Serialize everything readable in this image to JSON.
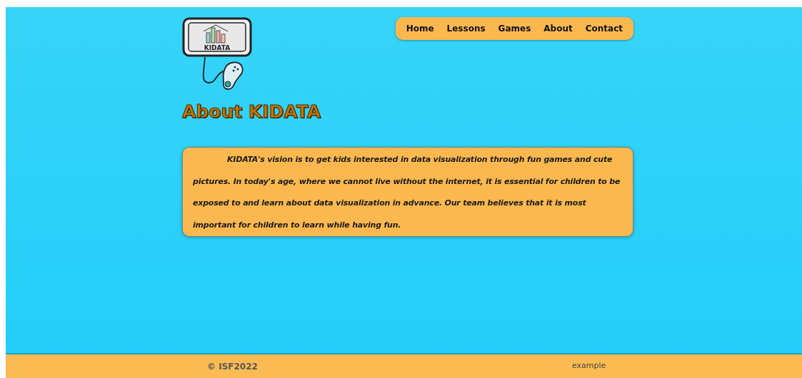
{
  "logo": {
    "text": "KIDATA"
  },
  "nav": [
    {
      "label": "Home"
    },
    {
      "label": "Lessons"
    },
    {
      "label": "Games"
    },
    {
      "label": "About"
    },
    {
      "label": "Contact"
    }
  ],
  "heading": "About KIDATA",
  "paragraph": "KIDATA's vision is to get kids interested in data visualization through fun games and cute pictures. In today's age, where we cannot live without the internet, it is essential for children to be exposed to and learn about data visualization in advance. Our team believes that it is most important for children to learn while having fun.",
  "footer": {
    "copyright": "© ISF2022",
    "link": "example"
  }
}
